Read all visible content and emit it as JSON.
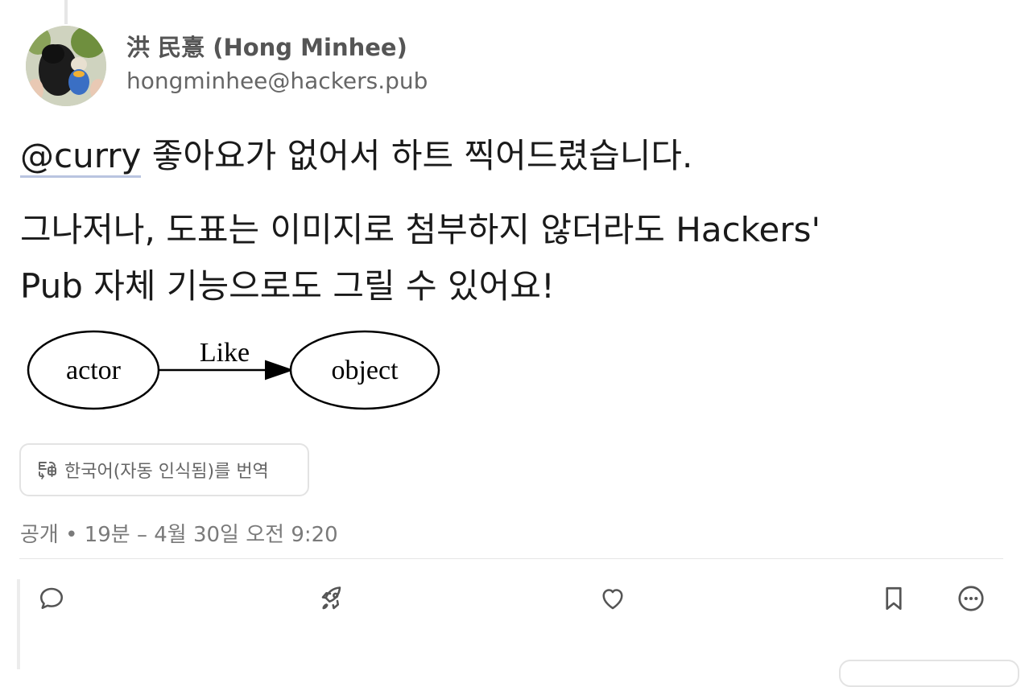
{
  "author": {
    "name": "洪 民憙 (Hong Minhee)",
    "handle": "hongminhee@hackers.pub"
  },
  "post": {
    "mention": "@curry",
    "line1_rest": " 좋아요가 없어서 하트 찍어드렸습니다.",
    "line2": "그나저나, 도표는 이미지로 첨부하지 않더라도 Hackers'",
    "line3": "Pub 자체 기능으로도 그릴 수 있어요!"
  },
  "diagram": {
    "source_node": "actor",
    "target_node": "object",
    "edge_label": "Like"
  },
  "translate_button": {
    "label": "한국어(자동 인식됨)를 번역",
    "icon": "translate-icon"
  },
  "meta": {
    "text": "공개 • 19분 – 4월 30일 오전 9:20"
  },
  "actions": {
    "reply_icon": "reply-icon",
    "boost_icon": "boost-rocket-icon",
    "like_icon": "heart-icon",
    "bookmark_icon": "bookmark-icon",
    "more_icon": "more-options-icon"
  },
  "colors": {
    "mention_underline": "#b9c4e0",
    "muted_text": "#7a7a7a",
    "border": "#e3e3e3"
  }
}
